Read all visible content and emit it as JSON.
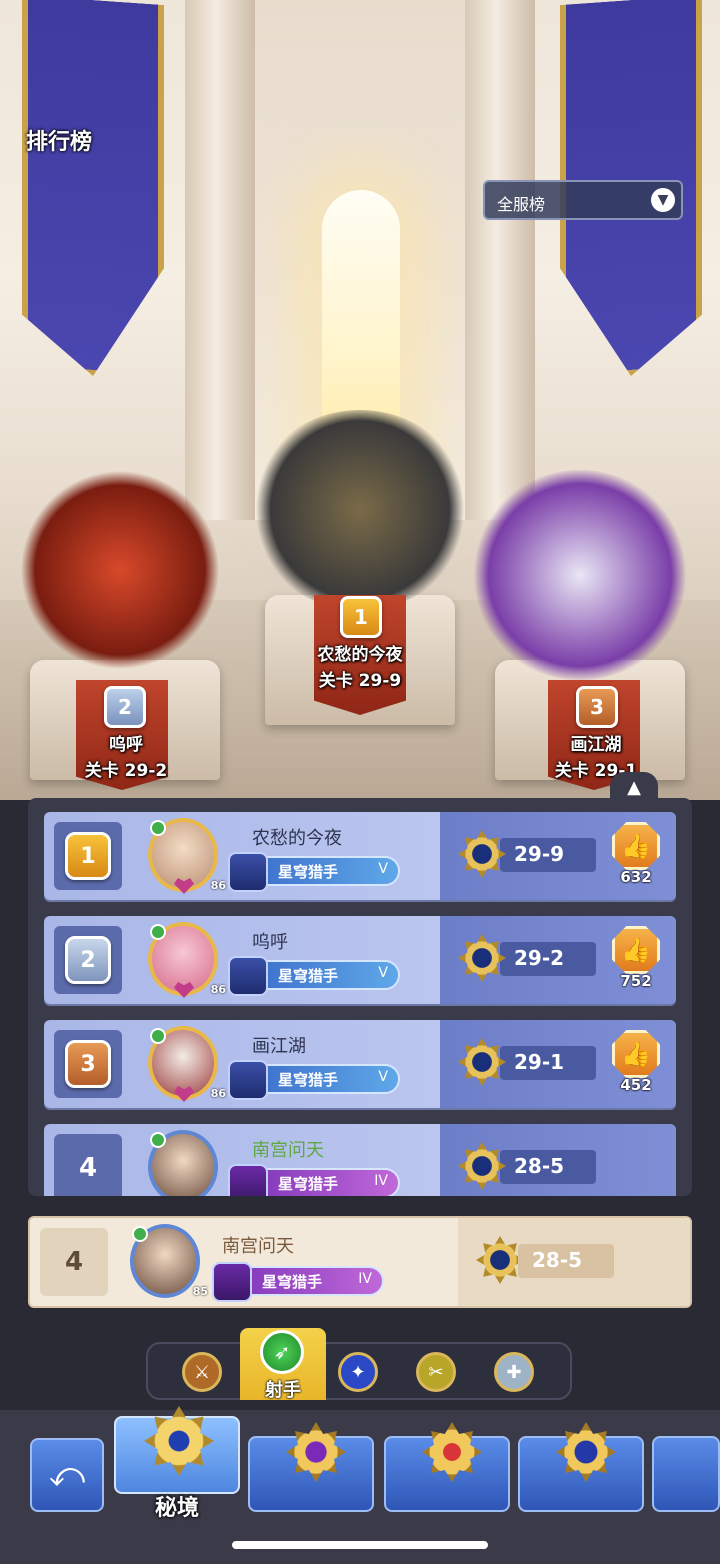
{
  "header": {
    "title": "排行榜"
  },
  "server_dropdown": {
    "label": "全服榜",
    "arrow_icon": "chevron-down-icon"
  },
  "podium": [
    {
      "rank": "1",
      "name": "农愁的今夜",
      "stage": "关卡 29-9"
    },
    {
      "rank": "2",
      "name": "呜呼",
      "stage": "关卡 29-2"
    },
    {
      "rank": "3",
      "name": "画江湖",
      "stage": "关卡 29-1"
    }
  ],
  "leaderboard": [
    {
      "rank": "1",
      "name": "农愁的今夜",
      "level": "86",
      "title": "星穹猎手",
      "tier": "V",
      "stage": "29-9",
      "likes": "632"
    },
    {
      "rank": "2",
      "name": "呜呼",
      "level": "86",
      "title": "星穹猎手",
      "tier": "V",
      "stage": "29-2",
      "likes": "752"
    },
    {
      "rank": "3",
      "name": "画江湖",
      "level": "86",
      "title": "星穹猎手",
      "tier": "V",
      "stage": "29-1",
      "likes": "452"
    },
    {
      "rank": "4",
      "name": "南宫问天",
      "title": "星穹猎手",
      "tier": "IV",
      "stage": "28-5"
    }
  ],
  "my_rank": {
    "rank": "4",
    "name": "南宫问天",
    "level": "85",
    "title": "星穹猎手",
    "tier": "IV",
    "stage": "28-5"
  },
  "class_filter": {
    "selected_label": "射手",
    "icons": [
      "warrior-icon",
      "archer-icon",
      "mage-icon",
      "assassin-icon",
      "support-icon"
    ]
  },
  "bottom_nav": {
    "selected_label": "秘境"
  },
  "colors": {
    "gold": "#e8b52a",
    "panel": "#3a3b4a",
    "row": "#a9b7e8"
  }
}
